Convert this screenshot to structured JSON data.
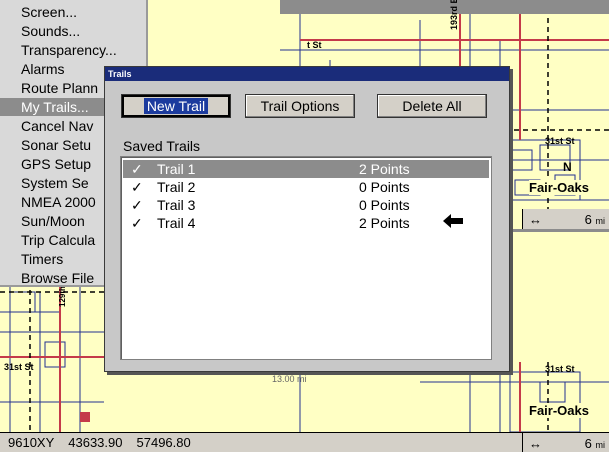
{
  "menu": {
    "items": [
      {
        "label": "Screen..."
      },
      {
        "label": "Sounds..."
      },
      {
        "label": "Transparency..."
      },
      {
        "label": "Alarms"
      },
      {
        "label": "Route Plann"
      },
      {
        "label": "My Trails..."
      },
      {
        "label": "Cancel Nav"
      },
      {
        "label": "Sonar Setu"
      },
      {
        "label": "GPS Setup"
      },
      {
        "label": "System Se"
      },
      {
        "label": "NMEA 2000"
      },
      {
        "label": "Sun/Moon"
      },
      {
        "label": "Trip Calcula"
      },
      {
        "label": "Timers"
      },
      {
        "label": "Browse File"
      }
    ],
    "selected_index": 5
  },
  "dialog": {
    "title": "Trails",
    "buttons": {
      "new_trail": "New Trail",
      "trail_options": "Trail Options",
      "delete_all": "Delete All"
    },
    "saved_label": "Saved Trails",
    "trails": [
      {
        "check": "✓",
        "name": "Trail 1",
        "points": "2 Points",
        "selected": true
      },
      {
        "check": "✓",
        "name": "Trail 2",
        "points": "0 Points",
        "selected": false
      },
      {
        "check": "✓",
        "name": "Trail 3",
        "points": "0 Points",
        "selected": false
      },
      {
        "check": "✓",
        "name": "Trail 4",
        "points": "2 Points",
        "selected": false
      }
    ],
    "cursor_glyph": "🡐"
  },
  "map": {
    "labels": {
      "st1": "t St",
      "ave_193": "193rd E",
      "st_31_top": "31st St",
      "n_marker": "N",
      "fair_oaks_top": "Fair-Oaks",
      "ave_129": "129th E",
      "st_31_left": "31st St",
      "st_31_bot": "31st St",
      "fair_oaks_bot": "Fair-Oaks",
      "dist": "13.00 mi"
    },
    "scale_top": {
      "arrow": "↔",
      "value": "6",
      "unit": "mi"
    }
  },
  "status": {
    "waypoint": "9610XY",
    "x": "43633.90",
    "y": "57496.80",
    "scale": {
      "arrow": "↔",
      "value": "6",
      "unit": "mi"
    }
  },
  "colors": {
    "map_bg": "#ffffc4",
    "road_red": "#c43a4a",
    "road_blue": "#23308f",
    "titlebar": "#1a2c7a",
    "selection": "#8c8c8c"
  }
}
